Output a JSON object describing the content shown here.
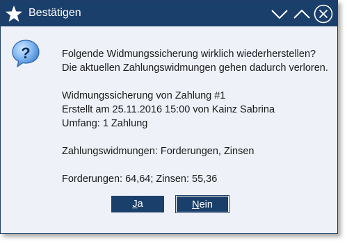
{
  "window": {
    "title": "Bestätigen",
    "app_icon": "star-icon",
    "controls": [
      "minimize-icon",
      "maximize-icon",
      "close-icon"
    ]
  },
  "dialog": {
    "icon": "question-icon",
    "lines": [
      "Folgende Widmungssicherung wirklich wiederherstellen?",
      "Die aktuellen Zahlungswidmungen gehen dadurch verloren.",
      "Widmungssicherung von Zahlung #1",
      "Erstellt am 25.11.2016 15:00 von Kainz Sabrina",
      "Umfang: 1 Zahlung",
      "Zahlungswidmungen: Forderungen, Zinsen",
      "Forderungen: 64,64; Zinsen: 55,36"
    ]
  },
  "buttons": {
    "yes": {
      "mnemonic": "J",
      "rest": "a"
    },
    "no": {
      "mnemonic": "N",
      "rest": "ein"
    }
  },
  "colors": {
    "titlebar": "#1b3f6b",
    "body": "#eef1f7",
    "button": "#1b3f6b",
    "text": "#1a1a1a"
  }
}
